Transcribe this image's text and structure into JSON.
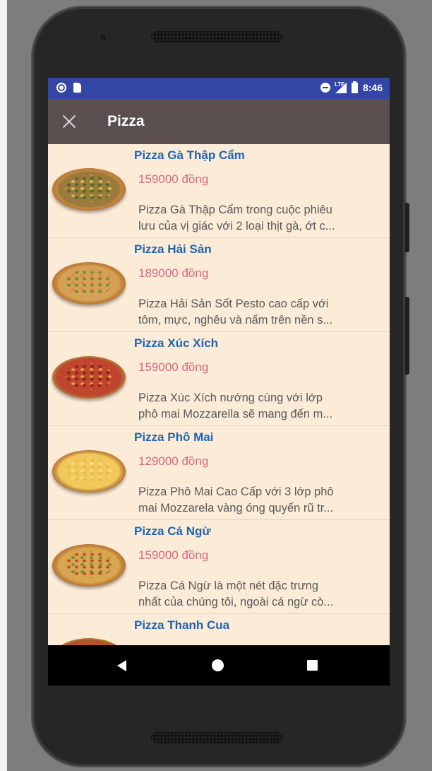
{
  "status_bar": {
    "time": "8:46",
    "network": "LTE"
  },
  "app_bar": {
    "title": "Pizza",
    "close_icon": "close-icon"
  },
  "items": [
    {
      "name": "Pizza Gà Thập Cẩm",
      "price": "159000 đồng",
      "desc_line1": "Pizza Gà Thập Cẩm trong cuộc phiêu",
      "desc_line2": "lưu của vị giác với 2 loại thịt gà, ớt c..."
    },
    {
      "name": "Pizza Hải Sản",
      "price": "189000 đồng",
      "desc_line1": "Pizza Hải Sản Sốt Pesto cao cấp với",
      "desc_line2": "tôm, mực, nghêu và nấm trên nền s..."
    },
    {
      "name": "Pizza Xúc Xích",
      "price": "159000 đồng",
      "desc_line1": "Pizza Xúc Xích nướng cùng với lớp",
      "desc_line2": "phô mai Mozzarella sẽ mang đến m..."
    },
    {
      "name": "Pizza Phô Mai",
      "price": "129000 đồng",
      "desc_line1": "Pizza Phô Mai Cao Cấp với 3 lớp phô",
      "desc_line2": "mai Mozzarela vàng óng quyến rũ tr..."
    },
    {
      "name": "Pizza Cá Ngừ",
      "price": "159000 đồng",
      "desc_line1": "Pizza Cá Ngừ là một nét đặc trưng",
      "desc_line2": "nhất của chúng tôi, ngoài cá ngừ cò..."
    },
    {
      "name": "Pizza Thanh Cua"
    }
  ],
  "nav_bar": {
    "back": "back-icon",
    "home": "home-icon",
    "recents": "recents-icon"
  }
}
